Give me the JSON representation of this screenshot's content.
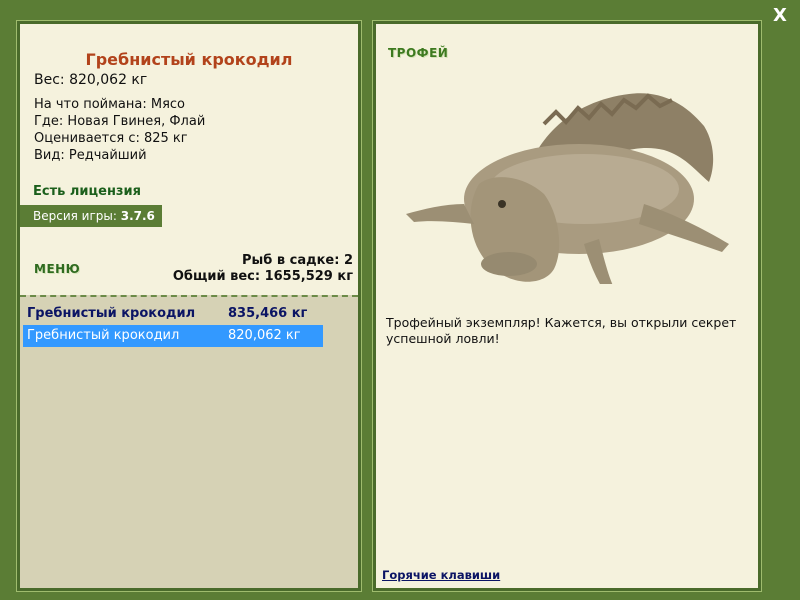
{
  "window": {
    "close_label": "X"
  },
  "catch": {
    "title": "Гребнистый крокодил",
    "weight": "Вес: 820,062 кг",
    "bait": "На что поймана: Мясо",
    "location": "Где: Новая Гвинея, Флай",
    "valued_from": "Оценивается с: 825 кг",
    "rarity": "Вид: Редчайший"
  },
  "license": "Есть лицензия",
  "version": {
    "label": "Версия игры:",
    "value": "3.7.6"
  },
  "menu_label": "МЕНЮ",
  "keep": {
    "count": "Рыб в садке: 2",
    "total": "Общий вес: 1655,529 кг"
  },
  "keep_list": [
    {
      "name": "Гребнистый крокодил",
      "weight": "835,466 кг"
    },
    {
      "name": "Гребнистый крокодил",
      "weight": "820,062 кг"
    }
  ],
  "trophy": {
    "label": "ТРОФЕЙ",
    "text": "Трофейный экземпляр! Кажется, вы открыли секрет успешной ловли!"
  },
  "hotkeys_label": "Горячие клавиши",
  "colors": {
    "background": "#5b7d35",
    "panel_fill": "#f5f2dd",
    "title_color": "#b2431b",
    "selection": "#3399ff",
    "link": "#0b1464"
  }
}
